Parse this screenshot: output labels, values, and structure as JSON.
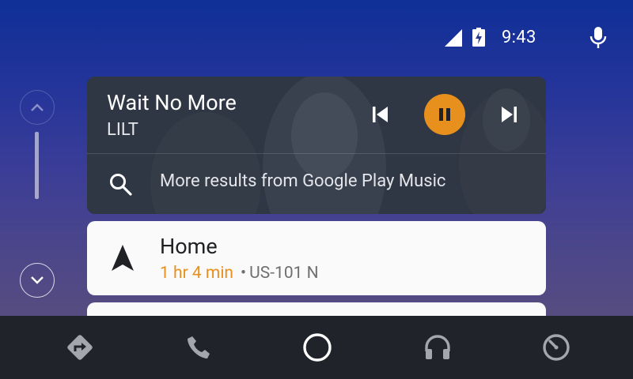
{
  "status_bar": {
    "time": "9:43",
    "icons": [
      "cell-signal-icon",
      "battery-charging-icon",
      "microphone-icon"
    ]
  },
  "scroll": {
    "icons": [
      "chevron-up-icon",
      "chevron-down-icon"
    ]
  },
  "media": {
    "title": "Wait No More",
    "artist": "LILT",
    "state": "playing",
    "accent_color": "#e8901e",
    "icons": [
      "skip-previous-icon",
      "pause-icon",
      "skip-next-icon",
      "search-icon"
    ],
    "search_label": "More results from Google Play Music"
  },
  "navigation": {
    "destination": "Home",
    "eta": "1 hr 4 min",
    "separator": "•",
    "route": "US-101 N",
    "icon": "navigation-arrow-icon"
  },
  "bottom_bar": {
    "items": [
      "navigation-icon",
      "phone-icon",
      "home-icon",
      "headphones-icon",
      "dashboard-icon"
    ]
  }
}
